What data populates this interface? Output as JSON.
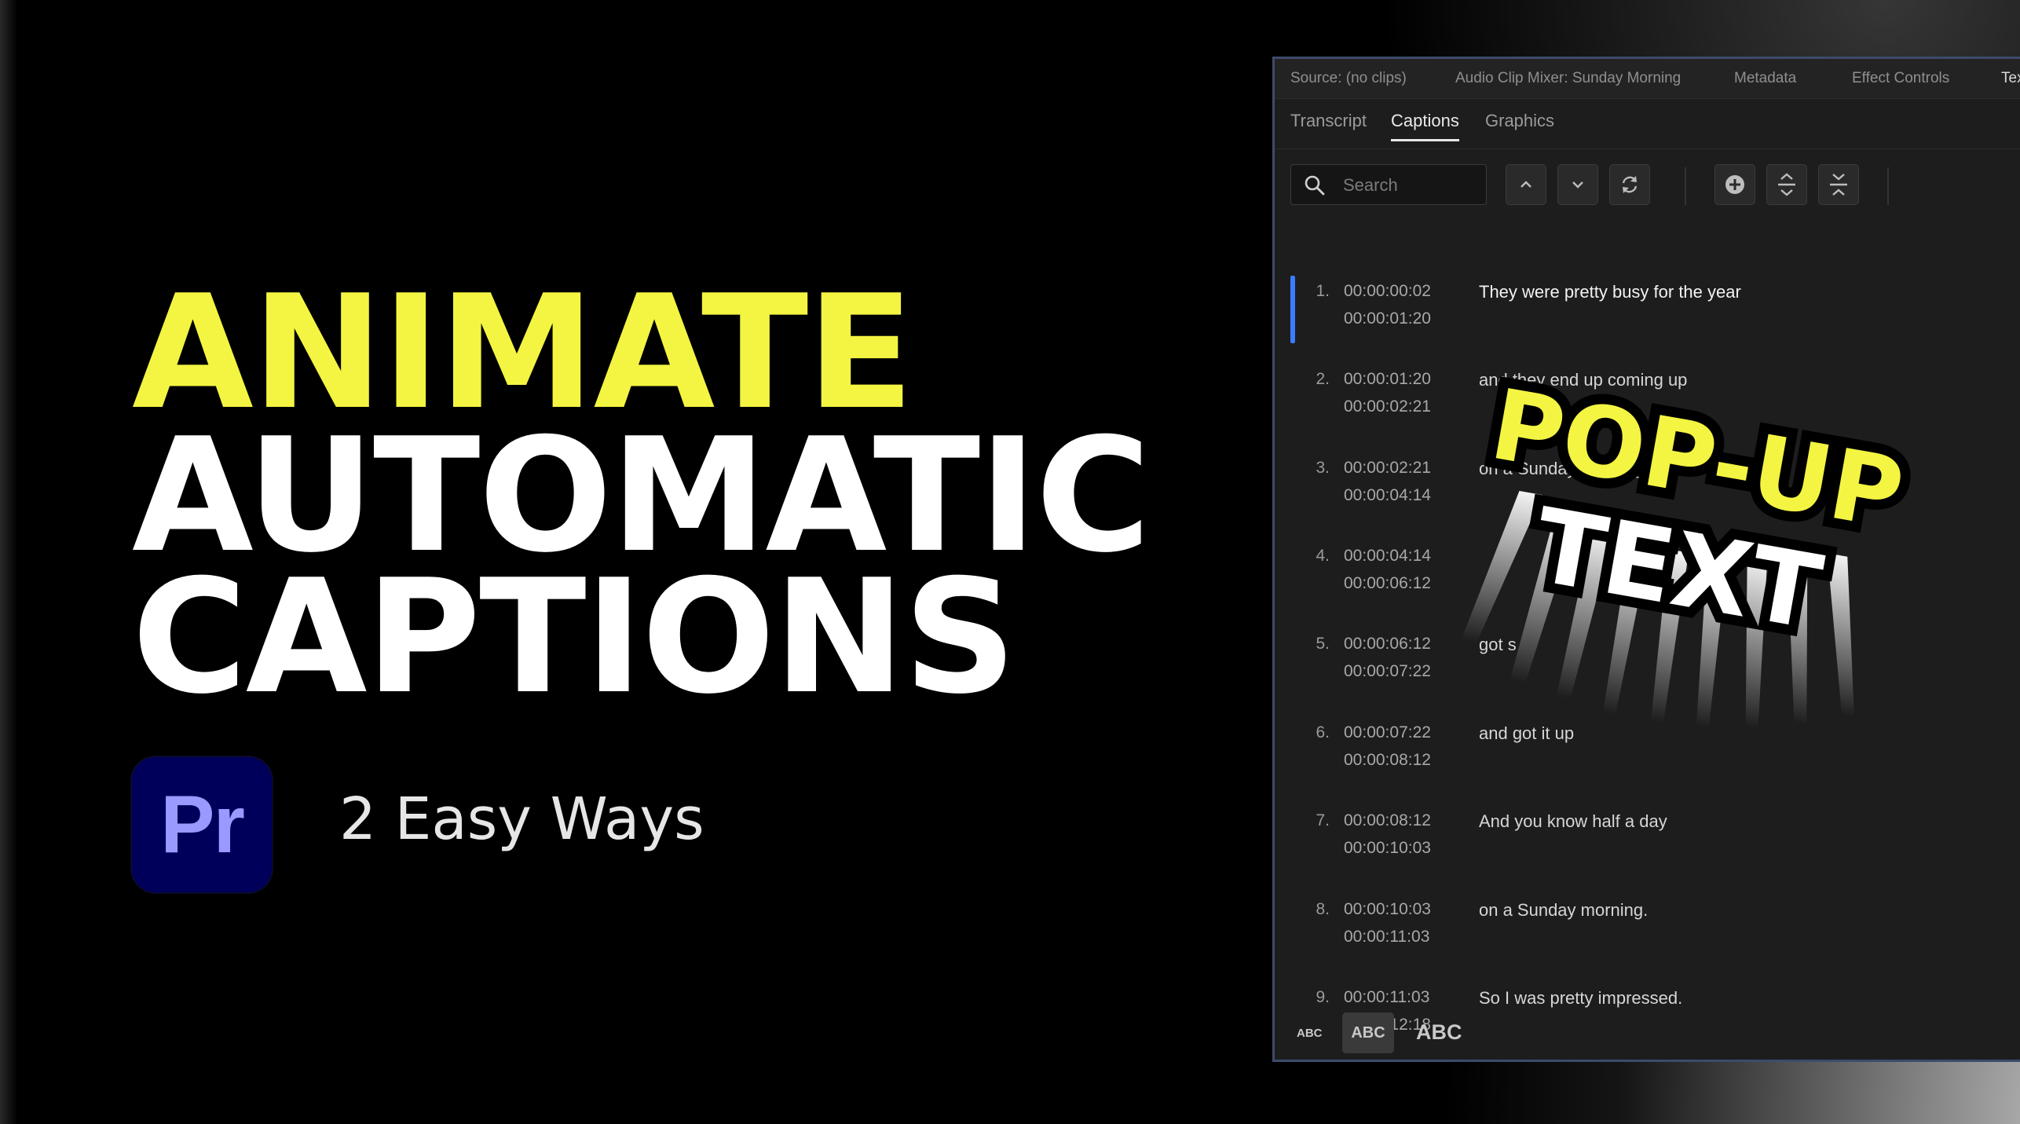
{
  "title": {
    "line1": "ANIMATE",
    "line2": "AUTOMATIC",
    "line3": "CAPTIONS",
    "accent_color": "#f3f542"
  },
  "logo": {
    "label": "Pr",
    "bg_color": "#00005b",
    "text_color": "#9999ff"
  },
  "subtitle": "2 Easy Ways",
  "panel": {
    "top_tabs": [
      "Source: (no clips)",
      "Audio Clip Mixer: Sunday Morning",
      "Metadata",
      "Effect Controls",
      "Tex"
    ],
    "sub_tabs": [
      "Transcript",
      "Captions",
      "Graphics"
    ],
    "active_sub_tab": "Captions",
    "search_placeholder": "Search",
    "toolbar_icons": [
      "chevron-up-icon",
      "chevron-down-icon",
      "refresh-icon",
      "add-circle-icon",
      "split-caption-icon",
      "merge-caption-icon"
    ],
    "captions": [
      {
        "num": "1.",
        "in": "00:00:00:02",
        "out": "00:00:01:20",
        "text": "They were pretty busy for the year"
      },
      {
        "num": "2.",
        "in": "00:00:01:20",
        "out": "00:00:02:21",
        "text": "and they end up coming up"
      },
      {
        "num": "3.",
        "in": "00:00:02:21",
        "out": "00:00:04:14",
        "text": "on a Sunday morning"
      },
      {
        "num": "4.",
        "in": "00:00:04:14",
        "out": "00:00:06:12",
        "text": ""
      },
      {
        "num": "5.",
        "in": "00:00:06:12",
        "out": "00:00:07:22",
        "text": "got s"
      },
      {
        "num": "6.",
        "in": "00:00:07:22",
        "out": "00:00:08:12",
        "text": "and got it up"
      },
      {
        "num": "7.",
        "in": "00:00:08:12",
        "out": "00:00:10:03",
        "text": "And you know half a day"
      },
      {
        "num": "8.",
        "in": "00:00:10:03",
        "out": "00:00:11:03",
        "text": "on a Sunday morning."
      },
      {
        "num": "9.",
        "in": "00:00:11:03",
        "out": "00:00:12:18",
        "text": "So I was pretty impressed."
      }
    ],
    "text_size_buttons": [
      "ABC",
      "ABC",
      "ABC"
    ],
    "selection_color": "#3b7dff"
  },
  "badge": {
    "line1": "POP-UP",
    "line2": "TEXT"
  }
}
